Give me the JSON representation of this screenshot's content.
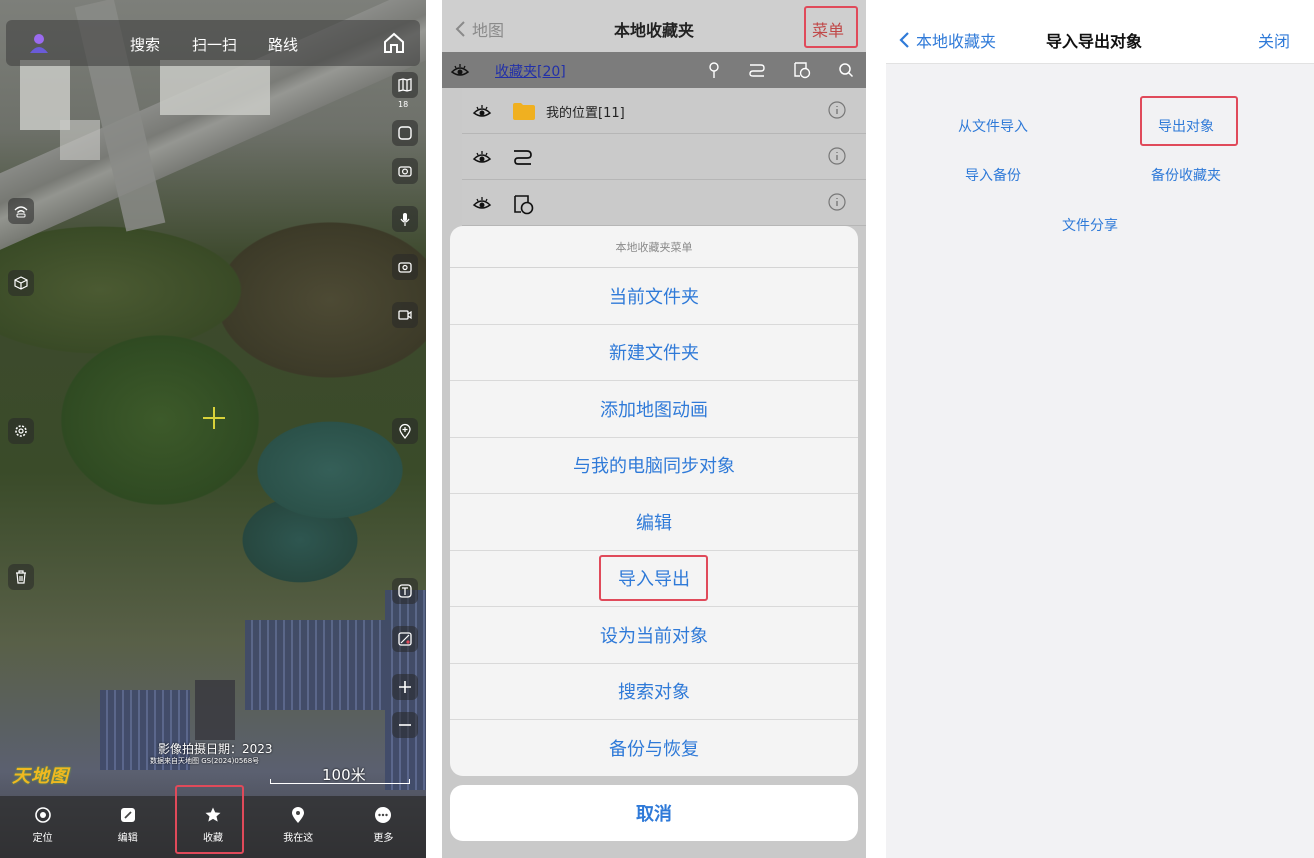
{
  "map_panel": {
    "topbar": {
      "search": "搜索",
      "scan": "扫一扫",
      "route": "路线"
    },
    "layer_badge": "18",
    "photo_date": "影像拍摄日期：2023",
    "data_source": "数据来自天地图 GS(2024)0568号",
    "scale": "100米",
    "logo": "天地图",
    "bottom_nav": [
      {
        "label": "定位",
        "icon": "locate-icon"
      },
      {
        "label": "编辑",
        "icon": "edit-icon"
      },
      {
        "label": "收藏",
        "icon": "favorite-icon"
      },
      {
        "label": "我在这",
        "icon": "pin-icon"
      },
      {
        "label": "更多",
        "icon": "more-icon"
      }
    ]
  },
  "favorites_panel": {
    "back_label": "地图",
    "title": "本地收藏夹",
    "menu_label": "菜单",
    "header_folder": "收藏夹[20]",
    "rows": [
      {
        "label": "我的位置[11]",
        "icon": "folder-icon"
      },
      {
        "label": "",
        "icon": "route-icon"
      },
      {
        "label": "",
        "icon": "polygon-icon"
      }
    ],
    "sheet": {
      "title": "本地收藏夹菜单",
      "items": [
        "当前文件夹",
        "新建文件夹",
        "添加地图动画",
        "与我的电脑同步对象",
        "编辑",
        "导入导出",
        "设为当前对象",
        "搜索对象",
        "备份与恢复"
      ],
      "cancel": "取消"
    }
  },
  "import_export_panel": {
    "back_label": "本地收藏夹",
    "title": "导入导出对象",
    "close_label": "关闭",
    "options": {
      "import_file": "从文件导入",
      "export_objects": "导出对象",
      "import_backup": "导入备份",
      "backup_favorites": "备份收藏夹",
      "file_share": "文件分享"
    }
  },
  "colors": {
    "accent": "#2f7ad8",
    "highlight": "#e04a5a"
  }
}
